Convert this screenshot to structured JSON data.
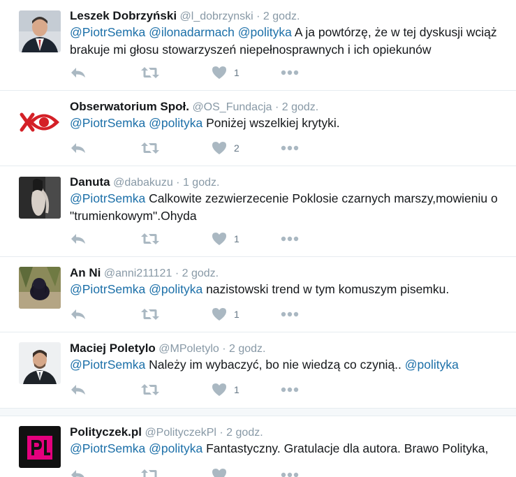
{
  "tweets": [
    {
      "name": "Leszek Dobrzyński",
      "handle": "@l_dobrzynski",
      "time": "2 godz.",
      "mentions": [
        "@PiotrSemka",
        "@ilonadarmach",
        "@polityka"
      ],
      "text": "A ja powtórzę, że w tej dyskusji wciąż brakuje mi głosu stowarzyszeń niepełnosprawnych i ich opiekunów",
      "likes": "1"
    },
    {
      "name": "Obserwatorium Społ.",
      "handle": "@OS_Fundacja",
      "time": "2 godz.",
      "mentions": [
        "@PiotrSemka",
        "@polityka"
      ],
      "text": "Poniżej wszelkiej krytyki.",
      "likes": "2"
    },
    {
      "name": "Danuta",
      "handle": "@dabakuzu",
      "time": "1 godz.",
      "mentions": [
        "@PiotrSemka"
      ],
      "text": "Calkowite zezwierzecenie Poklosie czarnych marszy,mowieniu o \"trumienkowym\".Ohyda",
      "likes": "1"
    },
    {
      "name": "An Ni",
      "handle": "@anni211121",
      "time": "2 godz.",
      "mentions": [
        "@PiotrSemka",
        "@polityka"
      ],
      "text": "nazistowski trend w tym komuszym pisemku.",
      "likes": "1"
    },
    {
      "name": "Maciej Poletylo",
      "handle": "@MPoletylo",
      "time": "2 godz.",
      "mentions": [
        "@PiotrSemka"
      ],
      "text": "Należy im wybaczyć, bo nie wiedzą co czynią..",
      "trailing_mention": "@polityka",
      "likes": "1"
    },
    {
      "name": "Polityczek.pl",
      "handle": "@PolityczekPl",
      "time": "2 godz.",
      "mentions": [
        "@PiotrSemka",
        "@polityka"
      ],
      "text": "Fantastyczny. Gratulacje dla autora. Brawo Polityka,",
      "likes": ""
    }
  ],
  "separator": "·",
  "icons": {
    "reply": "reply-icon",
    "retweet": "retweet-icon",
    "like": "heart-icon",
    "more": "more-dots-icon"
  },
  "colors": {
    "mention": "#1b6fa8",
    "meta": "#8899a6",
    "action": "#aab8c2",
    "polityczek_logo": "#e5007e"
  }
}
